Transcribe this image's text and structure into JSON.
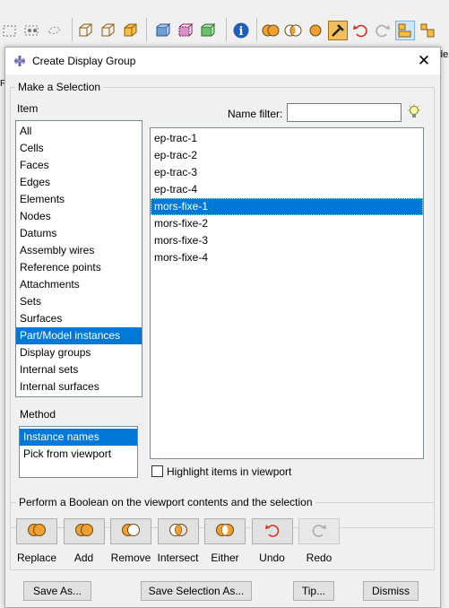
{
  "edge_texts": {
    "right_top": "de",
    "left_mid": "F"
  },
  "dialog": {
    "title": "Create Display Group",
    "close_glyph": "✕",
    "selection_group": "Make a Selection",
    "item_label": "Item",
    "name_filter_label": "Name filter:",
    "name_filter_value": "",
    "items": [
      "All",
      "Cells",
      "Faces",
      "Edges",
      "Elements",
      "Nodes",
      "Datums",
      "Assembly wires",
      "Reference points",
      "Attachments",
      "Sets",
      "Surfaces",
      "Part/Model instances",
      "Display groups",
      "Internal sets",
      "Internal surfaces"
    ],
    "selected_item": "Part/Model instances",
    "instances": [
      "ep-trac-1",
      "ep-trac-2",
      "ep-trac-3",
      "ep-trac-4",
      "mors-fixe-1",
      "mors-fixe-2",
      "mors-fixe-3",
      "mors-fixe-4"
    ],
    "selected_instance": "mors-fixe-1",
    "method_label": "Method",
    "methods": [
      "Instance names",
      "Pick from viewport"
    ],
    "selected_method": "Instance names",
    "highlight_label": "Highlight items in viewport",
    "highlight_checked": false,
    "boolean_group": "Perform a Boolean on the viewport contents and the selection",
    "boolean_buttons": [
      {
        "label": "Replace",
        "icon": "replace-icon"
      },
      {
        "label": "Add",
        "icon": "add-icon"
      },
      {
        "label": "Remove",
        "icon": "remove-icon"
      },
      {
        "label": "Intersect",
        "icon": "intersect-icon"
      },
      {
        "label": "Either",
        "icon": "either-icon"
      },
      {
        "label": "Undo",
        "icon": "undo-icon"
      },
      {
        "label": "Redo",
        "icon": "redo-icon"
      }
    ],
    "footer_buttons": {
      "save_as": "Save As...",
      "save_selection_as": "Save Selection As...",
      "tip": "Tip...",
      "dismiss": "Dismiss"
    }
  },
  "colors": {
    "selection": "#0078d7",
    "circle_fill": "#f0a030",
    "undo_red": "#d03020",
    "info_blue": "#1f5fb4"
  }
}
